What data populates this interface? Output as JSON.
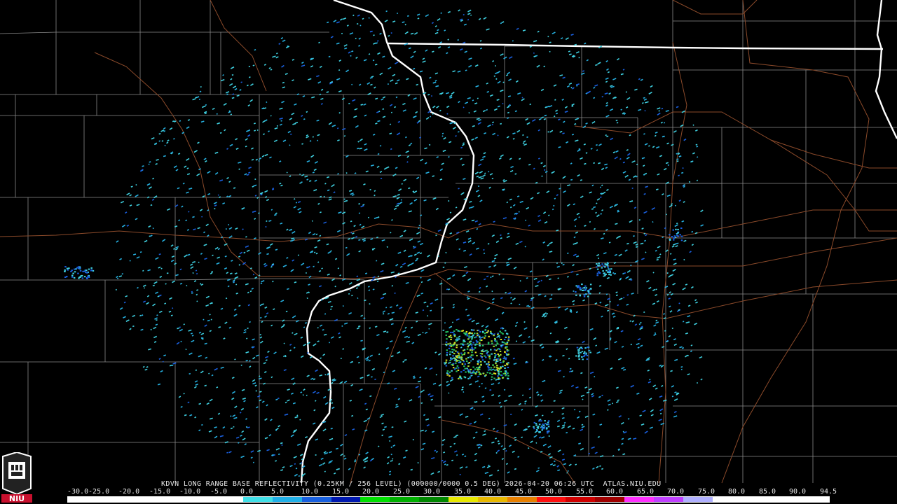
{
  "radar": {
    "caption": "KDVN LONG RANGE BASE REFLECTIVITY (0.25KM / 256 LEVEL) (000000/0000 0.5 DEG) 2026-04-20 06:26 UTC  ATLAS.NIU.EDU",
    "station": "KDVN",
    "product": "LONG RANGE BASE REFLECTIVITY",
    "datetime": "2026-04-20 06:26 UTC",
    "source": "ATLAS.NIU.EDU"
  },
  "scale": {
    "labels": [
      "-30.0",
      "-25.0",
      "-20.0",
      "-15.0",
      "-10.0",
      "-5.0",
      "0.0",
      "5.0",
      "10.0",
      "15.0",
      "20.0",
      "25.0",
      "30.0",
      "35.0",
      "40.0",
      "45.0",
      "50.0",
      "55.0",
      "60.0",
      "65.0",
      "70.0",
      "75.0",
      "80.0",
      "85.0",
      "90.0",
      "94.5"
    ],
    "colors": [
      "#ffffff",
      "#ffffff",
      "#ffffff",
      "#ffffff",
      "#ffffff",
      "#ffffff",
      "#40e0e8",
      "#20b0e8",
      "#1860e0",
      "#0018b0",
      "#00e000",
      "#00b000",
      "#008800",
      "#e8e800",
      "#e8b800",
      "#e88000",
      "#ff1010",
      "#d00000",
      "#a00000",
      "#ff30ff",
      "#c040ff",
      "#b0b0ff",
      "#ffffff",
      "#ffffff",
      "#ffffff",
      "#ffffff"
    ]
  },
  "map": {
    "state_line_color": "#ffffff",
    "county_line_color": "#8a8a8a",
    "highway_color": "#8b4a2a",
    "echo_colors": [
      "#3fd0e0",
      "#26b0e0",
      "#1a60e0",
      "#22c060",
      "#a8e030",
      "#e0e020"
    ]
  },
  "logo": {
    "text": "NIU",
    "color": "#c8102e"
  }
}
